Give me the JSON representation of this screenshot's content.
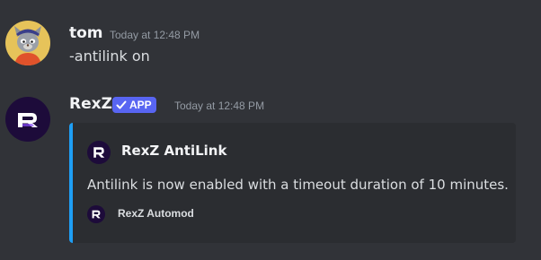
{
  "messages": [
    {
      "author": "tom",
      "timestamp": "Today at 12:48 PM",
      "content": "-antilink on"
    },
    {
      "author": "RexZ",
      "badge": "APP",
      "timestamp": "Today at 12:48 PM",
      "embed": {
        "accent_color": "#1e9ef4",
        "author_name": "RexZ AntiLink",
        "description": "Antilink is now enabled with a timeout duration of 10 minutes.",
        "footer_text": "RexZ Automod"
      }
    }
  ],
  "colors": {
    "background": "#313338",
    "embed_background": "#2b2d31",
    "badge": "#5865f2",
    "bot_avatar": "#1d0b3a"
  },
  "icons": {
    "tom_avatar": "cartoon-cat-avatar",
    "bot_avatar": "rexz-logo",
    "badge_check": "checkmark-icon"
  }
}
